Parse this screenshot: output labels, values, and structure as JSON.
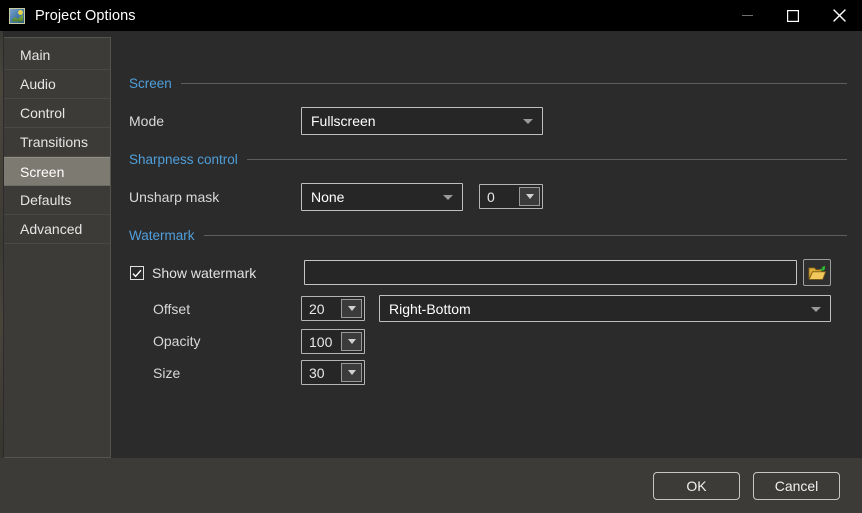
{
  "window": {
    "title": "Project Options",
    "icon": "app-image-icon",
    "controls": {
      "minimize": "minimize-icon",
      "maximize": "maximize-icon",
      "close": "close-icon"
    }
  },
  "sidebar": {
    "items": [
      {
        "label": "Main",
        "selected": false
      },
      {
        "label": "Audio",
        "selected": false
      },
      {
        "label": "Control",
        "selected": false
      },
      {
        "label": "Transitions",
        "selected": false
      },
      {
        "label": "Screen",
        "selected": true
      },
      {
        "label": "Defaults",
        "selected": false
      },
      {
        "label": "Advanced",
        "selected": false
      }
    ]
  },
  "groups": {
    "screen": {
      "title": "Screen",
      "mode_label": "Mode",
      "mode_value": "Fullscreen"
    },
    "sharpness": {
      "title": "Sharpness control",
      "unsharp_label": "Unsharp mask",
      "unsharp_value": "None",
      "amount_value": "0"
    },
    "watermark": {
      "title": "Watermark",
      "show_label": "Show watermark",
      "show_checked": true,
      "path_value": "",
      "path_placeholder": "",
      "browse_icon": "open-folder-icon",
      "offset_label": "Offset",
      "offset_value": "20",
      "position_value": "Right-Bottom",
      "opacity_label": "Opacity",
      "opacity_value": "100",
      "size_label": "Size",
      "size_value": "30"
    }
  },
  "footer": {
    "ok_label": "OK",
    "cancel_label": "Cancel"
  },
  "colors": {
    "accent": "#4f9fdb",
    "titlebar_bg": "#000000",
    "panel_bg": "#2b2b2b",
    "sidebar_bg": "#3c3b38",
    "selected_bg": "#7d7a72"
  }
}
